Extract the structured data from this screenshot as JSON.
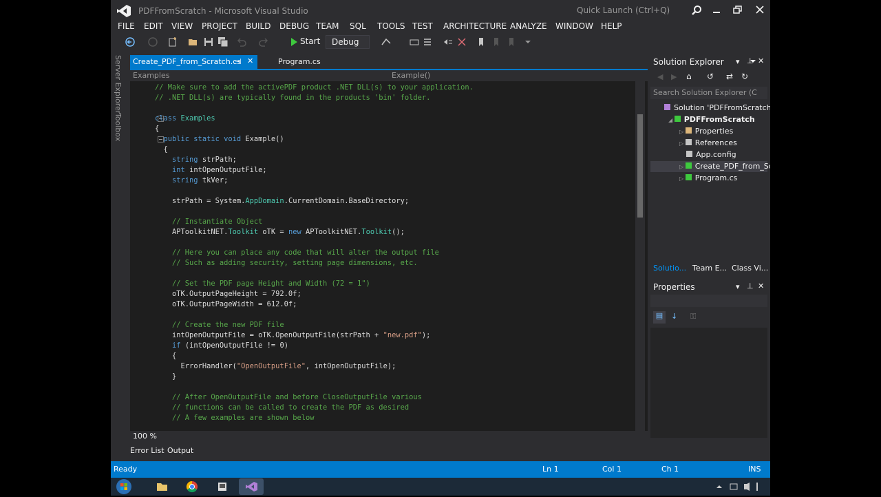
{
  "window": {
    "title": "PDFFromScratch - Microsoft Visual Studio",
    "quick_launch_placeholder": "Quick Launch (Ctrl+Q)"
  },
  "menu": [
    "FILE",
    "EDIT",
    "VIEW",
    "PROJECT",
    "BUILD",
    "DEBUG",
    "TEAM",
    "SQL",
    "TOOLS",
    "TEST",
    "ARCHITECTURE",
    "ANALYZE",
    "WINDOW",
    "HELP"
  ],
  "toolbar": {
    "start_label": "Start",
    "config": "Debug"
  },
  "left_tabs": [
    "Server Explorer",
    "Toolbox"
  ],
  "tabs": [
    {
      "label": "Create_PDF_from_Scratch.cs",
      "active": true
    },
    {
      "label": "Program.cs",
      "active": false
    }
  ],
  "navbar": {
    "scope": "Examples",
    "member": "Example()"
  },
  "code_lines": [
    {
      "indent": 0,
      "parts": [
        {
          "t": "// Make sure to add the activePDF product .NET DLL(s) to your application.",
          "c": "cm"
        }
      ]
    },
    {
      "indent": 0,
      "parts": [
        {
          "t": "// .NET DLL(s) are typically found in the products 'bin' folder.",
          "c": "cm"
        }
      ]
    },
    {
      "indent": 0,
      "parts": []
    },
    {
      "indent": 0,
      "parts": [
        {
          "t": "class ",
          "c": "kw"
        },
        {
          "t": "Examples",
          "c": "ty"
        }
      ]
    },
    {
      "indent": 0,
      "parts": [
        {
          "t": "{",
          "c": ""
        }
      ]
    },
    {
      "indent": 1,
      "parts": [
        {
          "t": "public static void ",
          "c": "kw"
        },
        {
          "t": "Example()",
          "c": ""
        }
      ]
    },
    {
      "indent": 1,
      "parts": [
        {
          "t": "{",
          "c": ""
        }
      ]
    },
    {
      "indent": 2,
      "parts": [
        {
          "t": "string ",
          "c": "kw"
        },
        {
          "t": "strPath;",
          "c": ""
        }
      ]
    },
    {
      "indent": 2,
      "parts": [
        {
          "t": "int ",
          "c": "kw"
        },
        {
          "t": "intOpenOutputFile;",
          "c": ""
        }
      ]
    },
    {
      "indent": 2,
      "parts": [
        {
          "t": "string ",
          "c": "kw"
        },
        {
          "t": "tkVer;",
          "c": ""
        }
      ]
    },
    {
      "indent": 0,
      "parts": []
    },
    {
      "indent": 2,
      "parts": [
        {
          "t": "strPath = System.",
          "c": ""
        },
        {
          "t": "AppDomain",
          "c": "ty"
        },
        {
          "t": ".CurrentDomain.BaseDirectory;",
          "c": ""
        }
      ]
    },
    {
      "indent": 0,
      "parts": []
    },
    {
      "indent": 2,
      "parts": [
        {
          "t": "// Instantiate Object",
          "c": "cm"
        }
      ]
    },
    {
      "indent": 2,
      "parts": [
        {
          "t": "APToolkitNET.",
          "c": ""
        },
        {
          "t": "Toolkit",
          "c": "ty"
        },
        {
          "t": " oTK = ",
          "c": ""
        },
        {
          "t": "new ",
          "c": "kw"
        },
        {
          "t": "APToolkitNET.",
          "c": ""
        },
        {
          "t": "Toolkit",
          "c": "ty"
        },
        {
          "t": "();",
          "c": ""
        }
      ]
    },
    {
      "indent": 0,
      "parts": []
    },
    {
      "indent": 2,
      "parts": [
        {
          "t": "// Here you can place any code that will alter the output file",
          "c": "cm"
        }
      ]
    },
    {
      "indent": 2,
      "parts": [
        {
          "t": "// Such as adding security, setting page dimensions, etc.",
          "c": "cm"
        }
      ]
    },
    {
      "indent": 0,
      "parts": []
    },
    {
      "indent": 2,
      "parts": [
        {
          "t": "// Set the PDF page Height and Width (72 = 1\")",
          "c": "cm"
        }
      ]
    },
    {
      "indent": 2,
      "parts": [
        {
          "t": "oTK.OutputPageHeight = 792.0f;",
          "c": ""
        }
      ]
    },
    {
      "indent": 2,
      "parts": [
        {
          "t": "oTK.OutputPageWidth = 612.0f;",
          "c": ""
        }
      ]
    },
    {
      "indent": 0,
      "parts": []
    },
    {
      "indent": 2,
      "parts": [
        {
          "t": "// Create the new PDF file",
          "c": "cm"
        }
      ]
    },
    {
      "indent": 2,
      "parts": [
        {
          "t": "intOpenOutputFile = oTK.OpenOutputFile(strPath + ",
          "c": ""
        },
        {
          "t": "\"new.pdf\"",
          "c": "st"
        },
        {
          "t": ");",
          "c": ""
        }
      ]
    },
    {
      "indent": 2,
      "parts": [
        {
          "t": "if ",
          "c": "kw"
        },
        {
          "t": "(intOpenOutputFile != 0)",
          "c": ""
        }
      ]
    },
    {
      "indent": 2,
      "parts": [
        {
          "t": "{",
          "c": ""
        }
      ]
    },
    {
      "indent": 3,
      "parts": [
        {
          "t": "ErrorHandler(",
          "c": ""
        },
        {
          "t": "\"OpenOutputFile\"",
          "c": "st"
        },
        {
          "t": ", intOpenOutputFile);",
          "c": ""
        }
      ]
    },
    {
      "indent": 2,
      "parts": [
        {
          "t": "}",
          "c": ""
        }
      ]
    },
    {
      "indent": 0,
      "parts": []
    },
    {
      "indent": 2,
      "parts": [
        {
          "t": "// After OpenOutputFile and before CloseOutputFile various",
          "c": "cm"
        }
      ]
    },
    {
      "indent": 2,
      "parts": [
        {
          "t": "// functions can be called to create the PDF as desired",
          "c": "cm"
        }
      ]
    },
    {
      "indent": 2,
      "parts": [
        {
          "t": "// A few examples are shown below",
          "c": "cm"
        }
      ]
    }
  ],
  "zoom": "100 %",
  "solution_explorer": {
    "title": "Solution Explorer",
    "search_placeholder": "Search Solution Explorer (C",
    "items": [
      {
        "label": "Solution 'PDFFromScratch' (",
        "level": 0,
        "icon": "solution-icon"
      },
      {
        "label": "PDFFromScratch",
        "level": 1,
        "icon": "csharp-project-icon",
        "bold": true
      },
      {
        "label": "Properties",
        "level": 2,
        "icon": "wrench-icon"
      },
      {
        "label": "References",
        "level": 2,
        "icon": "references-icon"
      },
      {
        "label": "App.config",
        "level": 2,
        "icon": "config-file-icon"
      },
      {
        "label": "Create_PDF_from_Scr",
        "level": 2,
        "icon": "csharp-file-icon",
        "selected": true
      },
      {
        "label": "Program.cs",
        "level": 2,
        "icon": "csharp-file-icon"
      }
    ],
    "tabs": [
      "Solutio...",
      "Team E...",
      "Class Vi..."
    ]
  },
  "properties": {
    "title": "Properties"
  },
  "bottom_tabs": [
    "Error List",
    "Output"
  ],
  "status": {
    "ready": "Ready",
    "ln": "Ln 1",
    "col": "Col 1",
    "ch": "Ch 1",
    "ins": "INS"
  },
  "colors": {
    "accent": "#007acc",
    "bg": "#2d2d30",
    "editor_bg": "#1e1e1e",
    "comment": "#57a64a",
    "keyword": "#569cd6",
    "type": "#4ec9b0",
    "string": "#d69d85"
  }
}
